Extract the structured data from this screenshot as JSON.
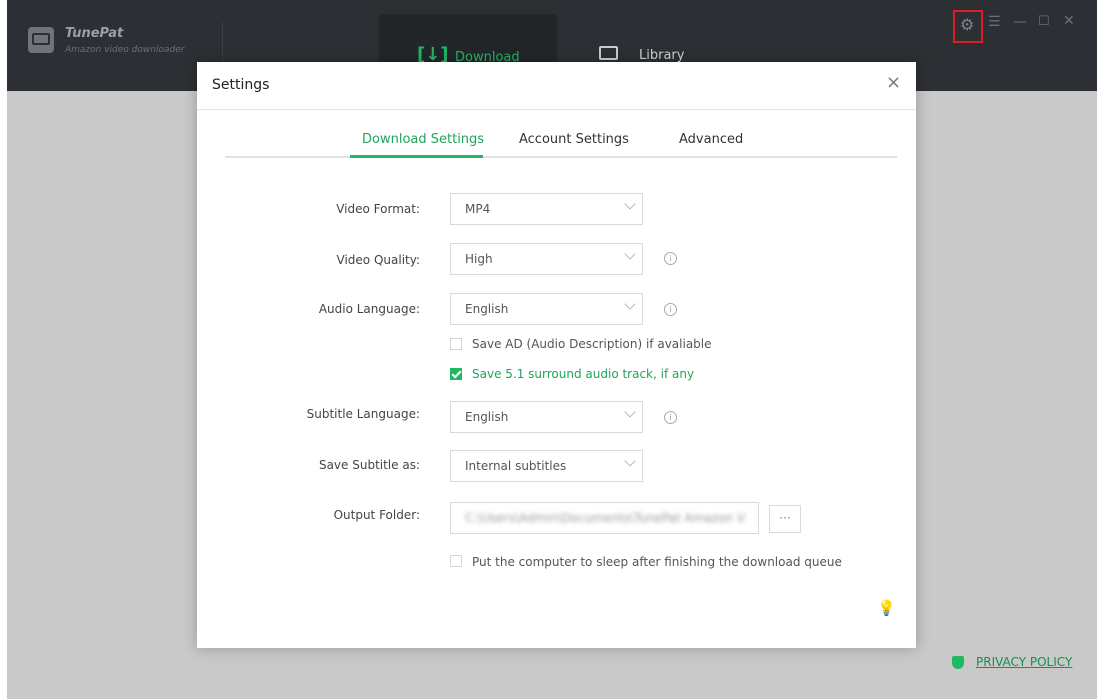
{
  "app": {
    "name": "TunePat",
    "subtitle": "Amazon video downloader",
    "tabs": {
      "download": "Download",
      "library": "Library"
    },
    "privacy_policy": "PRIVACY POLICY",
    "icons": {
      "gear": "gear-icon",
      "menu": "menu-icon",
      "minimize": "minimize-icon",
      "maximize": "maximize-icon",
      "close": "close-icon"
    },
    "accent_color": "#1fb864",
    "highlight_color": "#e01b24"
  },
  "dialog": {
    "title": "Settings",
    "close_glyph": "×",
    "tabs": [
      "Download Settings",
      "Account Settings",
      "Advanced"
    ],
    "active_tab": "Download Settings",
    "fields": {
      "video_format": {
        "label": "Video Format:",
        "value": "MP4"
      },
      "video_quality": {
        "label": "Video Quality:",
        "value": "High"
      },
      "audio_language": {
        "label": "Audio Language:",
        "value": "English"
      },
      "subtitle_language": {
        "label": "Subtitle Language:",
        "value": "English"
      },
      "save_subtitle": {
        "label": "Save Subtitle as:",
        "value": "Internal subtitles"
      },
      "output_folder": {
        "label": "Output Folder:",
        "value": "C:\\Users\\Admin\\Documents\\TunePat Amazon V",
        "browse": "···"
      }
    },
    "checkboxes": {
      "save_ad": {
        "label": "Save AD (Audio Description) if avaliable",
        "checked": false
      },
      "save_51": {
        "label": "Save 5.1 surround audio track, if any",
        "checked": true
      },
      "sleep": {
        "label": "Put the computer to sleep after finishing the download queue",
        "checked": false
      }
    }
  }
}
